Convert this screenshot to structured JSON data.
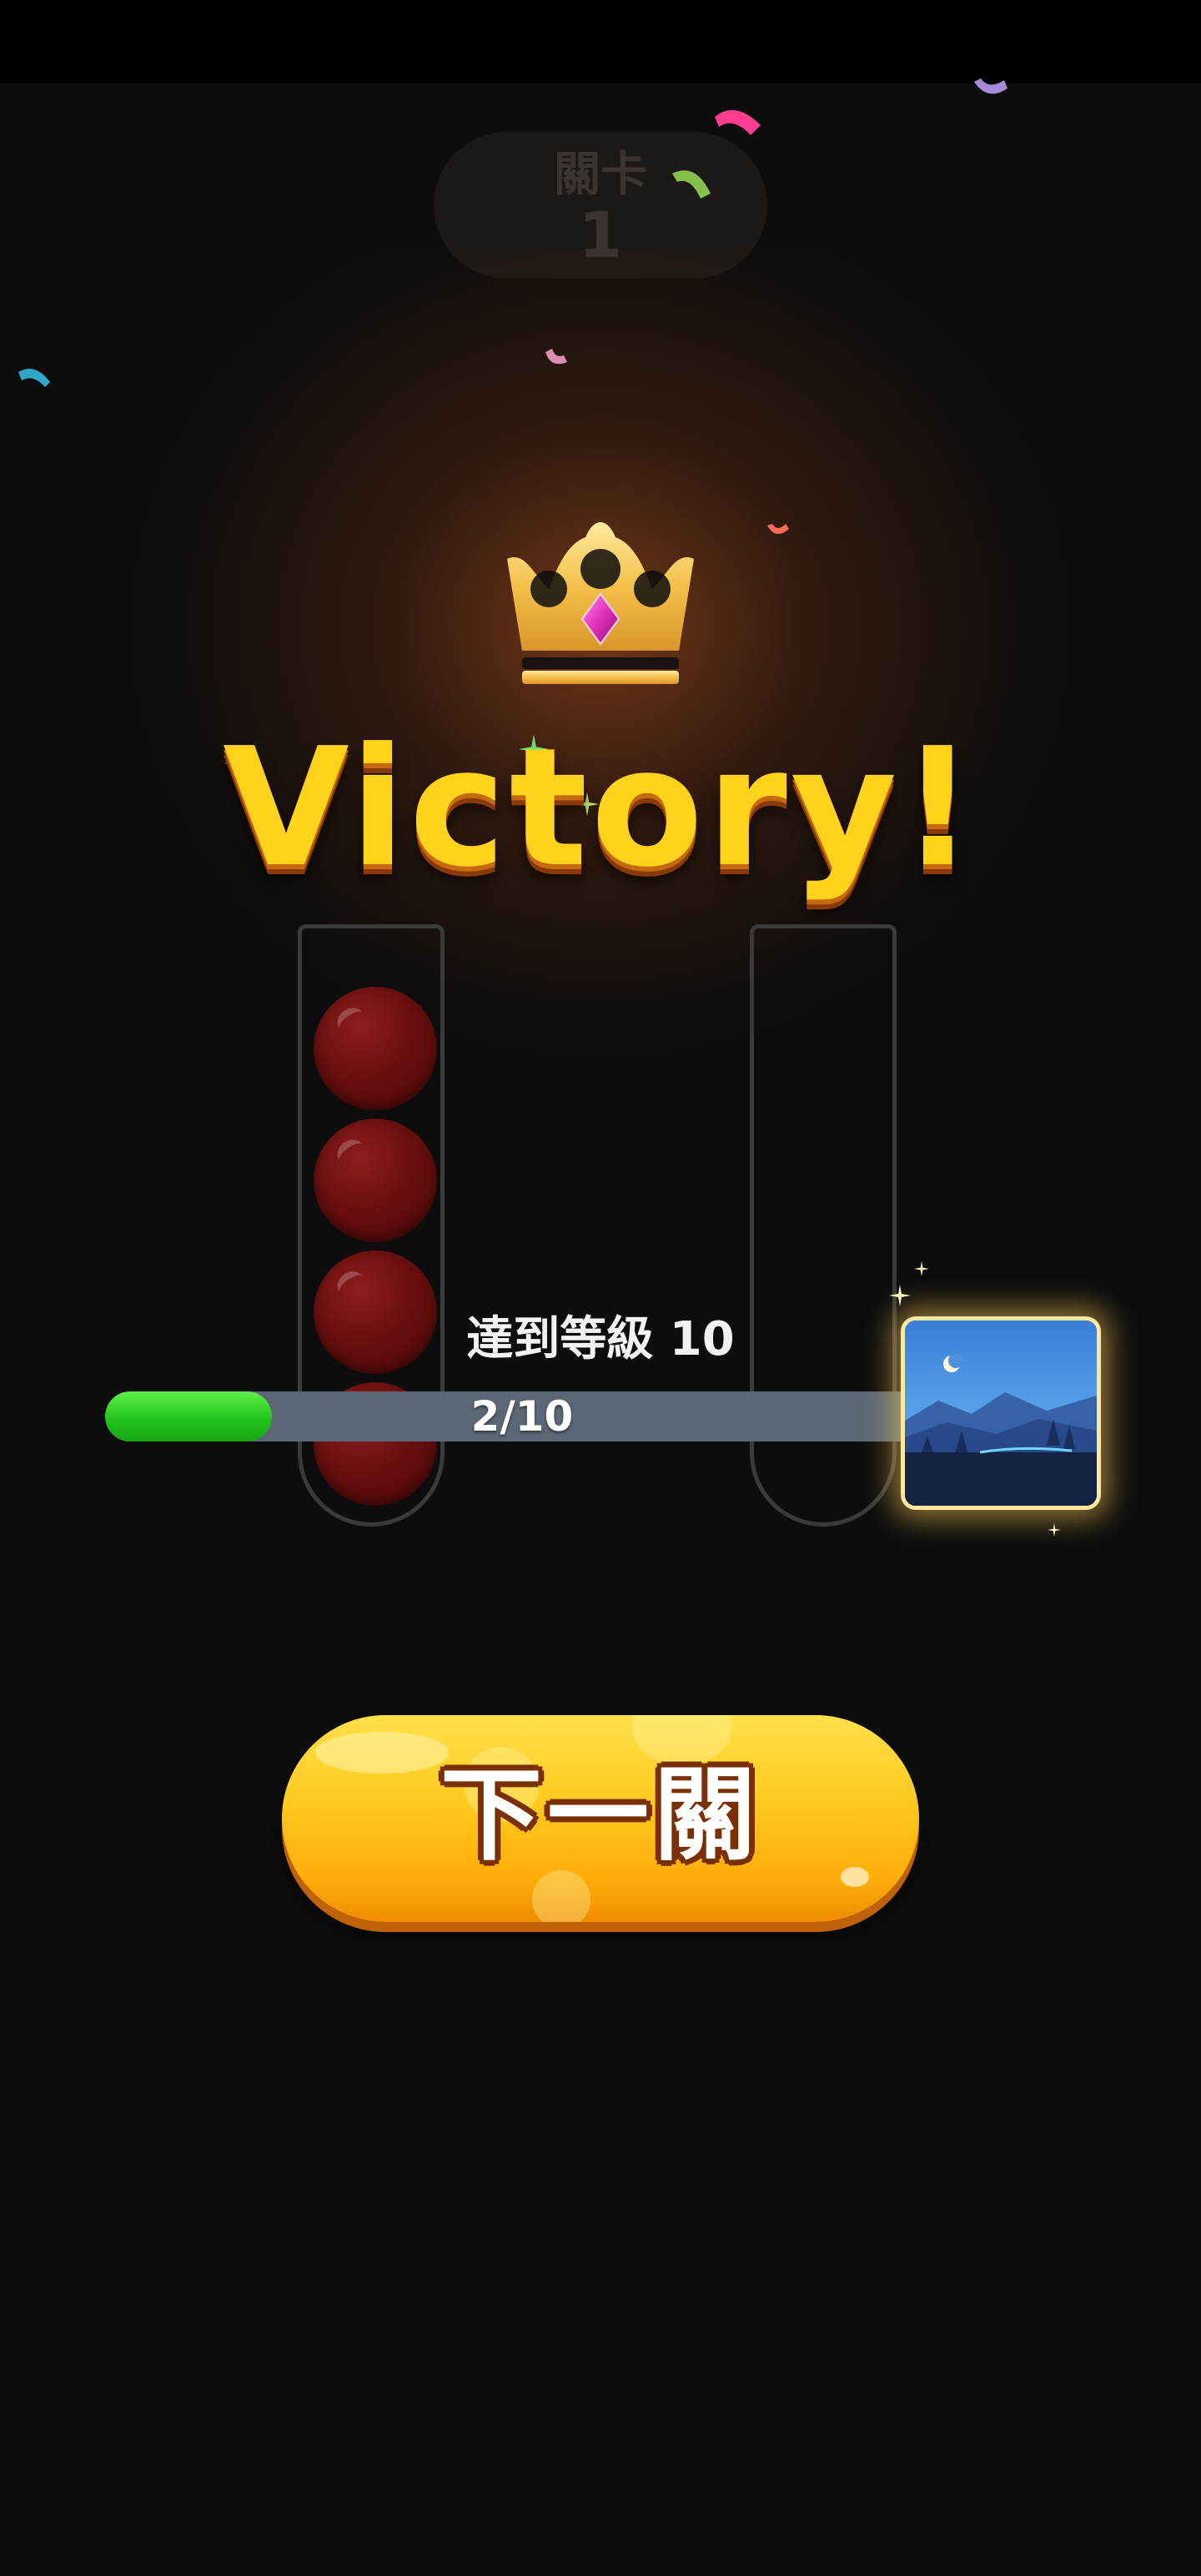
{
  "level": {
    "label": "關卡",
    "number": "1"
  },
  "result": {
    "title": "Victory!"
  },
  "progress": {
    "caption": "達到等級 10",
    "text": "2/10",
    "current": 2,
    "total": 10,
    "fill_fraction": 0.2
  },
  "reward": {
    "icon": "night-landscape-icon"
  },
  "tubes": [
    {
      "balls": [
        "red",
        "red",
        "red",
        "red"
      ]
    },
    {
      "balls": []
    }
  ],
  "next_button": {
    "label": "下一關"
  },
  "colors": {
    "accent": "#ffd21c",
    "ball": "#6a0f10",
    "progress_fill": "#22c41c",
    "progress_track": "#5b6774",
    "button": "#ffc81c"
  }
}
